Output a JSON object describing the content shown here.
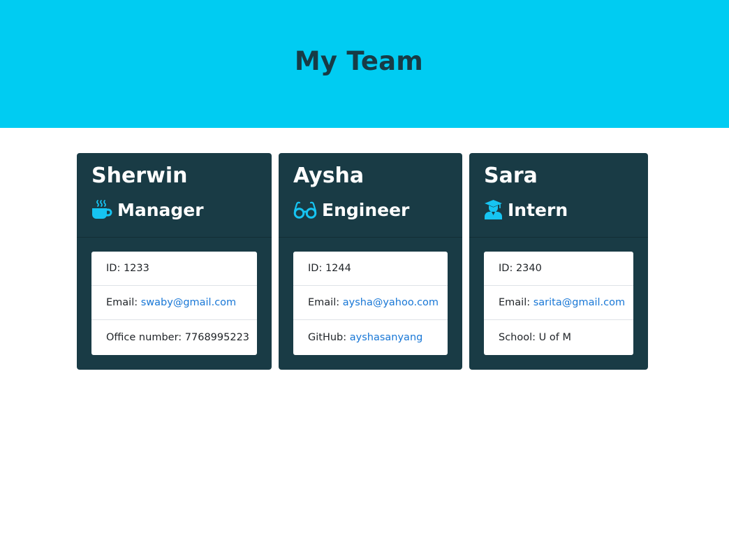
{
  "header": {
    "title": "My Team"
  },
  "colors": {
    "banner": "#00ccf2",
    "card": "#193b45",
    "icon": "#16c4f2",
    "link": "#1877d6"
  },
  "cards": [
    {
      "name": "Sherwin",
      "role": "Manager",
      "icon": "coffee-icon",
      "rows": [
        {
          "label": "ID:",
          "value": "1233"
        },
        {
          "label": "Email:",
          "value": "swaby@gmail.com"
        },
        {
          "label": "Office number:",
          "value": "7768995223"
        }
      ]
    },
    {
      "name": "Aysha",
      "role": "Engineer",
      "icon": "glasses-icon",
      "rows": [
        {
          "label": "ID:",
          "value": "1244"
        },
        {
          "label": "Email:",
          "value": "aysha@yahoo.com"
        },
        {
          "label": "GitHub:",
          "value": "ayshasanyang"
        }
      ]
    },
    {
      "name": "Sara",
      "role": "Intern",
      "icon": "graduate-icon",
      "rows": [
        {
          "label": "ID:",
          "value": "2340"
        },
        {
          "label": "Email:",
          "value": "sarita@gmail.com"
        },
        {
          "label": "School:",
          "value": "U of M"
        }
      ]
    }
  ]
}
